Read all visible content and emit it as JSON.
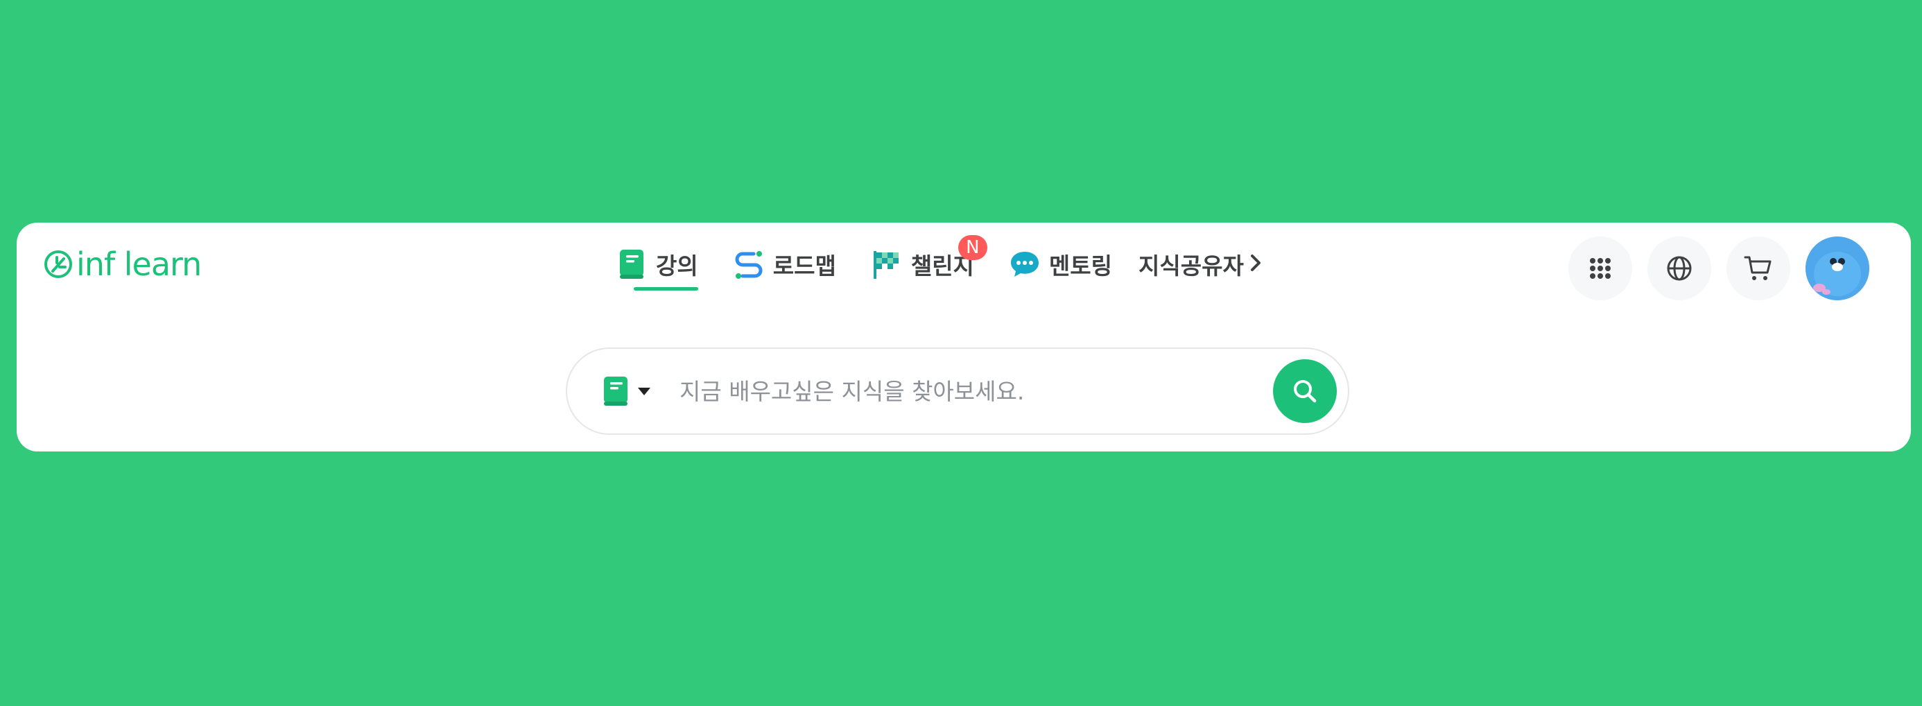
{
  "logo": {
    "text": "inf learn"
  },
  "nav": {
    "items": [
      {
        "label": "강의",
        "icon": "book-icon",
        "active": true
      },
      {
        "label": "로드맵",
        "icon": "roadmap-icon"
      },
      {
        "label": "챌린지",
        "icon": "flag-icon",
        "badge": "N"
      },
      {
        "label": "멘토링",
        "icon": "chat-bubble-icon"
      },
      {
        "label": "지식공유자",
        "icon": "chevron-right-icon"
      }
    ]
  },
  "header_actions": {
    "icons": [
      "grid-apps-icon",
      "globe-icon",
      "cart-icon",
      "avatar"
    ]
  },
  "search": {
    "type_icon": "book-icon",
    "placeholder": "지금 배우고싶은 지식을 찾아보세요.",
    "value": ""
  },
  "colors": {
    "background": "#33c97b",
    "brand": "#1dc078",
    "badge": "#ff5a5a",
    "text": "#3e4042"
  }
}
